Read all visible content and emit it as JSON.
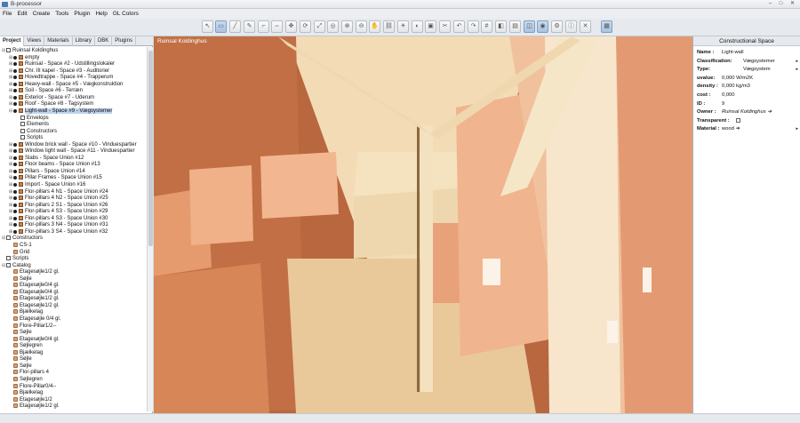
{
  "window": {
    "title": "B-processor",
    "min": "–",
    "max": "□",
    "close": "✕"
  },
  "menu": [
    "File",
    "Edit",
    "Create",
    "Tools",
    "Plugin",
    "Help",
    "GL Colors"
  ],
  "tabs": [
    "Project",
    "Views",
    "Materials",
    "Library",
    "DBK",
    "Plugins"
  ],
  "tree": [
    {
      "label": "Ruinsal Koldinghus",
      "depth": 0,
      "exp": "⊟",
      "icon": "folder"
    },
    {
      "label": "empty",
      "depth": 1,
      "exp": "⊞",
      "icon": "cube"
    },
    {
      "label": "Ruinsal - Space #2 - Udstillingslokaler",
      "depth": 1,
      "exp": "⊞",
      "icon": "cube"
    },
    {
      "label": "Chr. III kapel - Space #3 - Auditorier",
      "depth": 1,
      "exp": "⊞",
      "icon": "cube"
    },
    {
      "label": "Hovedtrappe - Space #4 - Trapperum",
      "depth": 1,
      "exp": "⊞",
      "icon": "cube"
    },
    {
      "label": "Heavy-wall - Space #5 - Vægkonstruktion",
      "depth": 1,
      "exp": "⊞",
      "icon": "cube"
    },
    {
      "label": "Soil - Space #6 - Terræn",
      "depth": 1,
      "exp": "⊞",
      "icon": "cube"
    },
    {
      "label": "Exterior - Space #7 - Uderum",
      "depth": 1,
      "exp": "⊞",
      "icon": "cube"
    },
    {
      "label": "Roof - Space #8 - Tagsystem",
      "depth": 1,
      "exp": "⊞",
      "icon": "cube"
    },
    {
      "label": "Light-wall - Space #9 - Vægsystemer",
      "depth": 1,
      "exp": "⊟",
      "icon": "cube",
      "selected": true
    },
    {
      "label": "Envelops",
      "depth": 2,
      "exp": "",
      "icon": "folder"
    },
    {
      "label": "Elements",
      "depth": 2,
      "exp": "",
      "icon": "folder"
    },
    {
      "label": "Constructors",
      "depth": 2,
      "exp": "",
      "icon": "folder"
    },
    {
      "label": "Scripts",
      "depth": 2,
      "exp": "",
      "icon": "folder"
    },
    {
      "label": "Window brick wall - Space #10 - Vinduespartier",
      "depth": 1,
      "exp": "⊞",
      "icon": "cube"
    },
    {
      "label": "Window light wall - Space #11 - Vinduespartier",
      "depth": 1,
      "exp": "⊞",
      "icon": "cube"
    },
    {
      "label": "Slabs - Space Union #12",
      "depth": 1,
      "exp": "⊞",
      "icon": "cube"
    },
    {
      "label": "Floor beams - Space Union #13",
      "depth": 1,
      "exp": "⊞",
      "icon": "cube"
    },
    {
      "label": "Pillars - Space Union #14",
      "depth": 1,
      "exp": "⊞",
      "icon": "cube"
    },
    {
      "label": "Pillar Frames - Space Union #15",
      "depth": 1,
      "exp": "⊞",
      "icon": "cube"
    },
    {
      "label": "Import - Space Union #16",
      "depth": 1,
      "exp": "⊞",
      "icon": "cube"
    },
    {
      "label": "Flor-pillars 4 N1 - Space Union #24",
      "depth": 1,
      "exp": "⊞",
      "icon": "cube"
    },
    {
      "label": "Flor-pillars 4 N2 - Space Union #25",
      "depth": 1,
      "exp": "⊞",
      "icon": "cube"
    },
    {
      "label": "Flor-pillars 2 S1 - Space Union #26",
      "depth": 1,
      "exp": "⊞",
      "icon": "cube"
    },
    {
      "label": "Flor-pillars 4 S3 - Space Union #29",
      "depth": 1,
      "exp": "⊞",
      "icon": "cube"
    },
    {
      "label": "Flor-pillars 4 S3 - Space Union #30",
      "depth": 1,
      "exp": "⊞",
      "icon": "cube"
    },
    {
      "label": "Flor-pillars 3 N4 - Space Union #31",
      "depth": 1,
      "exp": "⊞",
      "icon": "cube"
    },
    {
      "label": "Flor-pillars 3 S4 - Space Union #32",
      "depth": 1,
      "exp": "⊞",
      "icon": "cube"
    },
    {
      "label": "Constructors",
      "depth": 0,
      "exp": "⊟",
      "icon": "folder"
    },
    {
      "label": "CS-1",
      "depth": 1,
      "exp": "",
      "icon": "elem"
    },
    {
      "label": "Grid",
      "depth": 1,
      "exp": "",
      "icon": "elem"
    },
    {
      "label": "Scripts",
      "depth": 0,
      "exp": "",
      "icon": "folder"
    },
    {
      "label": "Catalog",
      "depth": 0,
      "exp": "⊟",
      "icon": "folder"
    },
    {
      "label": "Etagesøjle1/2 gl.",
      "depth": 1,
      "exp": "",
      "icon": "elem"
    },
    {
      "label": "Søjle",
      "depth": 1,
      "exp": "",
      "icon": "elem"
    },
    {
      "label": "Etagesøjle0/4 gl.",
      "depth": 1,
      "exp": "",
      "icon": "elem"
    },
    {
      "label": "Etagesøjle0/4 gl.",
      "depth": 1,
      "exp": "",
      "icon": "elem"
    },
    {
      "label": "Etagesøjle1/2 gl.",
      "depth": 1,
      "exp": "",
      "icon": "elem"
    },
    {
      "label": "Etagesøjle1/2 gl.",
      "depth": 1,
      "exp": "",
      "icon": "elem"
    },
    {
      "label": "Bjælkelag",
      "depth": 1,
      "exp": "",
      "icon": "elem"
    },
    {
      "label": "Etagesøjle 0/4 gl.",
      "depth": 1,
      "exp": "",
      "icon": "elem"
    },
    {
      "label": "Flore-Pillar1/2--",
      "depth": 1,
      "exp": "",
      "icon": "elem"
    },
    {
      "label": "Søjle",
      "depth": 1,
      "exp": "",
      "icon": "elem"
    },
    {
      "label": "Etagesøjle0/4 gl.",
      "depth": 1,
      "exp": "",
      "icon": "elem"
    },
    {
      "label": "Søjlegren",
      "depth": 1,
      "exp": "",
      "icon": "elem"
    },
    {
      "label": "Bjælkelag",
      "depth": 1,
      "exp": "",
      "icon": "elem"
    },
    {
      "label": "Søjle",
      "depth": 1,
      "exp": "",
      "icon": "elem"
    },
    {
      "label": "Søjle",
      "depth": 1,
      "exp": "",
      "icon": "elem"
    },
    {
      "label": "Flor-pillars 4",
      "depth": 1,
      "exp": "",
      "icon": "elem"
    },
    {
      "label": "Søjlegren",
      "depth": 1,
      "exp": "",
      "icon": "elem"
    },
    {
      "label": "Flore-Pillar0/4--",
      "depth": 1,
      "exp": "",
      "icon": "elem"
    },
    {
      "label": "Bjælkelag",
      "depth": 1,
      "exp": "",
      "icon": "elem"
    },
    {
      "label": "Etagesøjle1/2",
      "depth": 1,
      "exp": "",
      "icon": "elem"
    },
    {
      "label": "Etagesøjle1/2 gl.",
      "depth": 1,
      "exp": "",
      "icon": "elem"
    }
  ],
  "viewport": {
    "label": "Ruinsal Koldinghus"
  },
  "properties": {
    "header": "Constructional Space",
    "rows": [
      {
        "k": "Name :",
        "v": "Light-wall",
        "arrow": ""
      },
      {
        "k": "Classification:",
        "v": "Vægsystemer",
        "arrow": "▸"
      },
      {
        "k": "Type:",
        "v": "Vægsystem",
        "arrow": "▸"
      },
      {
        "k": "uvalue:",
        "v": "0,000 W/m2K",
        "arrow": ""
      },
      {
        "k": "density :",
        "v": "0,000 kg/m3",
        "arrow": ""
      },
      {
        "k": "cost :",
        "v": "0,000",
        "arrow": ""
      },
      {
        "k": "ID :",
        "v": "9",
        "arrow": ""
      },
      {
        "k": "Owner :",
        "v": "Ruinsal Koldinghus ➔",
        "arrow": ""
      },
      {
        "k": "Transparent :",
        "v": "",
        "arrow": ""
      },
      {
        "k": "Material :",
        "v": "wood ➔",
        "arrow": "▸"
      }
    ]
  }
}
